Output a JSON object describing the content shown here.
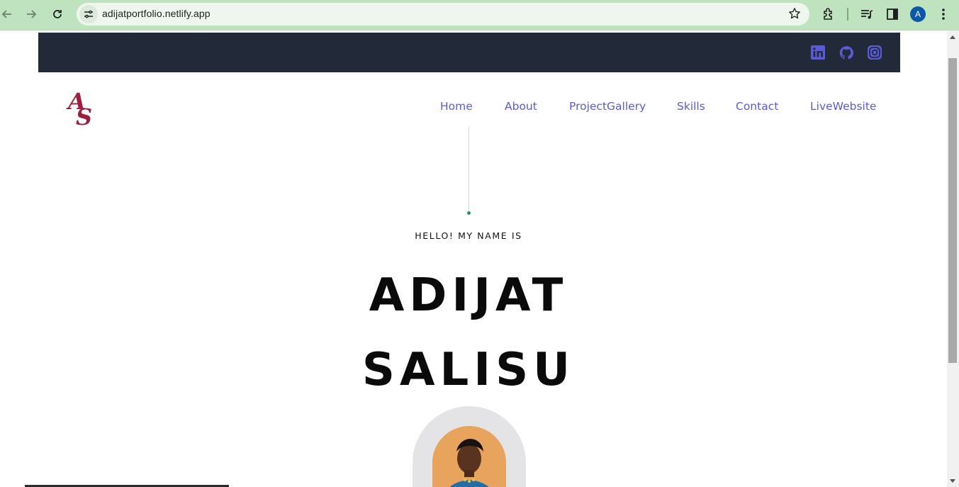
{
  "browser": {
    "url": "adijatportfolio.netlify.app",
    "profile_initial": "A",
    "icons": [
      "back-icon",
      "forward-icon",
      "reload-icon",
      "site-settings-icon",
      "bookmark-star-icon",
      "extensions-icon",
      "media-controls-icon",
      "side-panel-icon",
      "menu-kebab-icon"
    ]
  },
  "topbar": {
    "background": "#222a3a",
    "social_icons": [
      "linkedin-icon",
      "github-icon",
      "instagram-icon"
    ],
    "icon_color": "#5b5bd6"
  },
  "logo": {
    "letter1": "A",
    "letter2": "S",
    "color": "#9c1f3e"
  },
  "nav": {
    "items": [
      {
        "label": "Home"
      },
      {
        "label": "About"
      },
      {
        "label": "ProjectGallery"
      },
      {
        "label": "Skills"
      },
      {
        "label": "Contact"
      },
      {
        "label": "LiveWebsite"
      }
    ],
    "color": "#5b5bd6"
  },
  "hero": {
    "greeting": "HELLO! MY NAME IS",
    "first_name": "ADIJAT",
    "last_name": "SALISU",
    "accent_dot_color": "#1f9d55"
  }
}
